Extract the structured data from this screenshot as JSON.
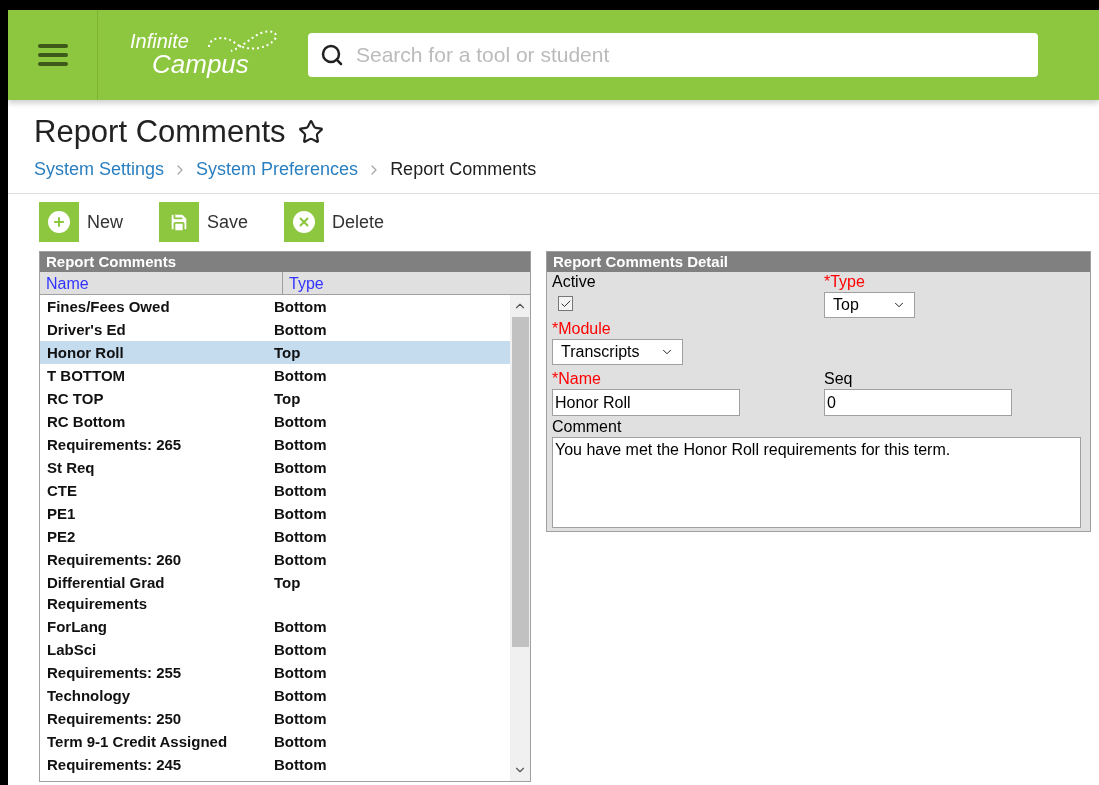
{
  "header": {
    "logo": {
      "line_1": "Infinite",
      "line_2": "Campus"
    },
    "search": {
      "placeholder": "Search for a tool or student"
    }
  },
  "page": {
    "title": "Report Comments",
    "favorite": false,
    "breadcrumbs": [
      {
        "label": "System Settings",
        "kind": "link"
      },
      {
        "label": "System Preferences",
        "kind": "link"
      },
      {
        "label": "Report Comments",
        "kind": "current"
      }
    ]
  },
  "toolbar": [
    {
      "label": "New",
      "kind": "new"
    },
    {
      "label": "Save",
      "kind": "save"
    },
    {
      "label": "Delete",
      "kind": "delete"
    }
  ],
  "list": {
    "title": "Report Comments",
    "columns": [
      "Name",
      "Type"
    ],
    "rows": [
      {
        "name": "Fines/Fees Owed",
        "type": "Bottom",
        "selected": false
      },
      {
        "name": "Driver's Ed",
        "type": "Bottom",
        "selected": false
      },
      {
        "name": "Honor Roll",
        "type": "Top",
        "selected": true
      },
      {
        "name": "T BOTTOM",
        "type": "Bottom",
        "selected": false
      },
      {
        "name": "RC TOP",
        "type": "Top",
        "selected": false
      },
      {
        "name": "RC Bottom",
        "type": "Bottom",
        "selected": false
      },
      {
        "name": "Requirements: 265",
        "type": "Bottom",
        "selected": false
      },
      {
        "name": "St Req",
        "type": "Bottom",
        "selected": false
      },
      {
        "name": "CTE",
        "type": "Bottom",
        "selected": false
      },
      {
        "name": "PE1",
        "type": "Bottom",
        "selected": false
      },
      {
        "name": "PE2",
        "type": "Bottom",
        "selected": false
      },
      {
        "name": "Requirements: 260",
        "type": "Bottom",
        "selected": false
      },
      {
        "name": "Differential Grad Requirements",
        "type": "Top",
        "selected": false
      },
      {
        "name": "ForLang",
        "type": "Bottom",
        "selected": false
      },
      {
        "name": "LabSci",
        "type": "Bottom",
        "selected": false
      },
      {
        "name": "Requirements: 255",
        "type": "Bottom",
        "selected": false
      },
      {
        "name": "Technology",
        "type": "Bottom",
        "selected": false
      },
      {
        "name": "Requirements: 250",
        "type": "Bottom",
        "selected": false
      },
      {
        "name": "Term 9-1 Credit Assigned",
        "type": "Bottom",
        "selected": false
      },
      {
        "name": "Requirements: 245",
        "type": "Bottom",
        "selected": false
      }
    ]
  },
  "detail": {
    "title": "Report Comments Detail",
    "active": {
      "label": "Active",
      "checked": true
    },
    "type": {
      "label": "*Type",
      "required": true,
      "value": "Top"
    },
    "module": {
      "label": "*Module",
      "required": true,
      "value": "Transcripts"
    },
    "name": {
      "label": "*Name",
      "required": true,
      "value": "Honor Roll"
    },
    "seq": {
      "label": "Seq",
      "required": false,
      "value": "0"
    },
    "comment": {
      "label": "Comment",
      "value": "You have met the Honor Roll requirements for this term."
    }
  }
}
